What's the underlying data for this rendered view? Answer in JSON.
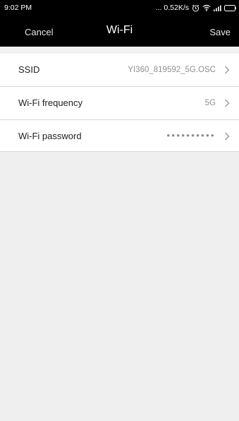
{
  "status_bar": {
    "time": "9:02 PM",
    "network_speed": "... 0.52K/s",
    "icons": [
      "alarm-icon",
      "wifi-icon",
      "signal-icon",
      "battery-icon"
    ]
  },
  "header": {
    "cancel_label": "Cancel",
    "title": "Wi-Fi",
    "save_label": "Save"
  },
  "settings": {
    "items": [
      {
        "label": "SSID",
        "value": "YI360_819592_5G.OSC"
      },
      {
        "label": "Wi-Fi frequency",
        "value": "5G"
      },
      {
        "label": "Wi-Fi password",
        "value": "••••••••••"
      }
    ]
  },
  "colors": {
    "header_bg": "#000000",
    "page_bg": "#efefef",
    "row_bg": "#ffffff",
    "value_text": "#8f8f8f"
  }
}
